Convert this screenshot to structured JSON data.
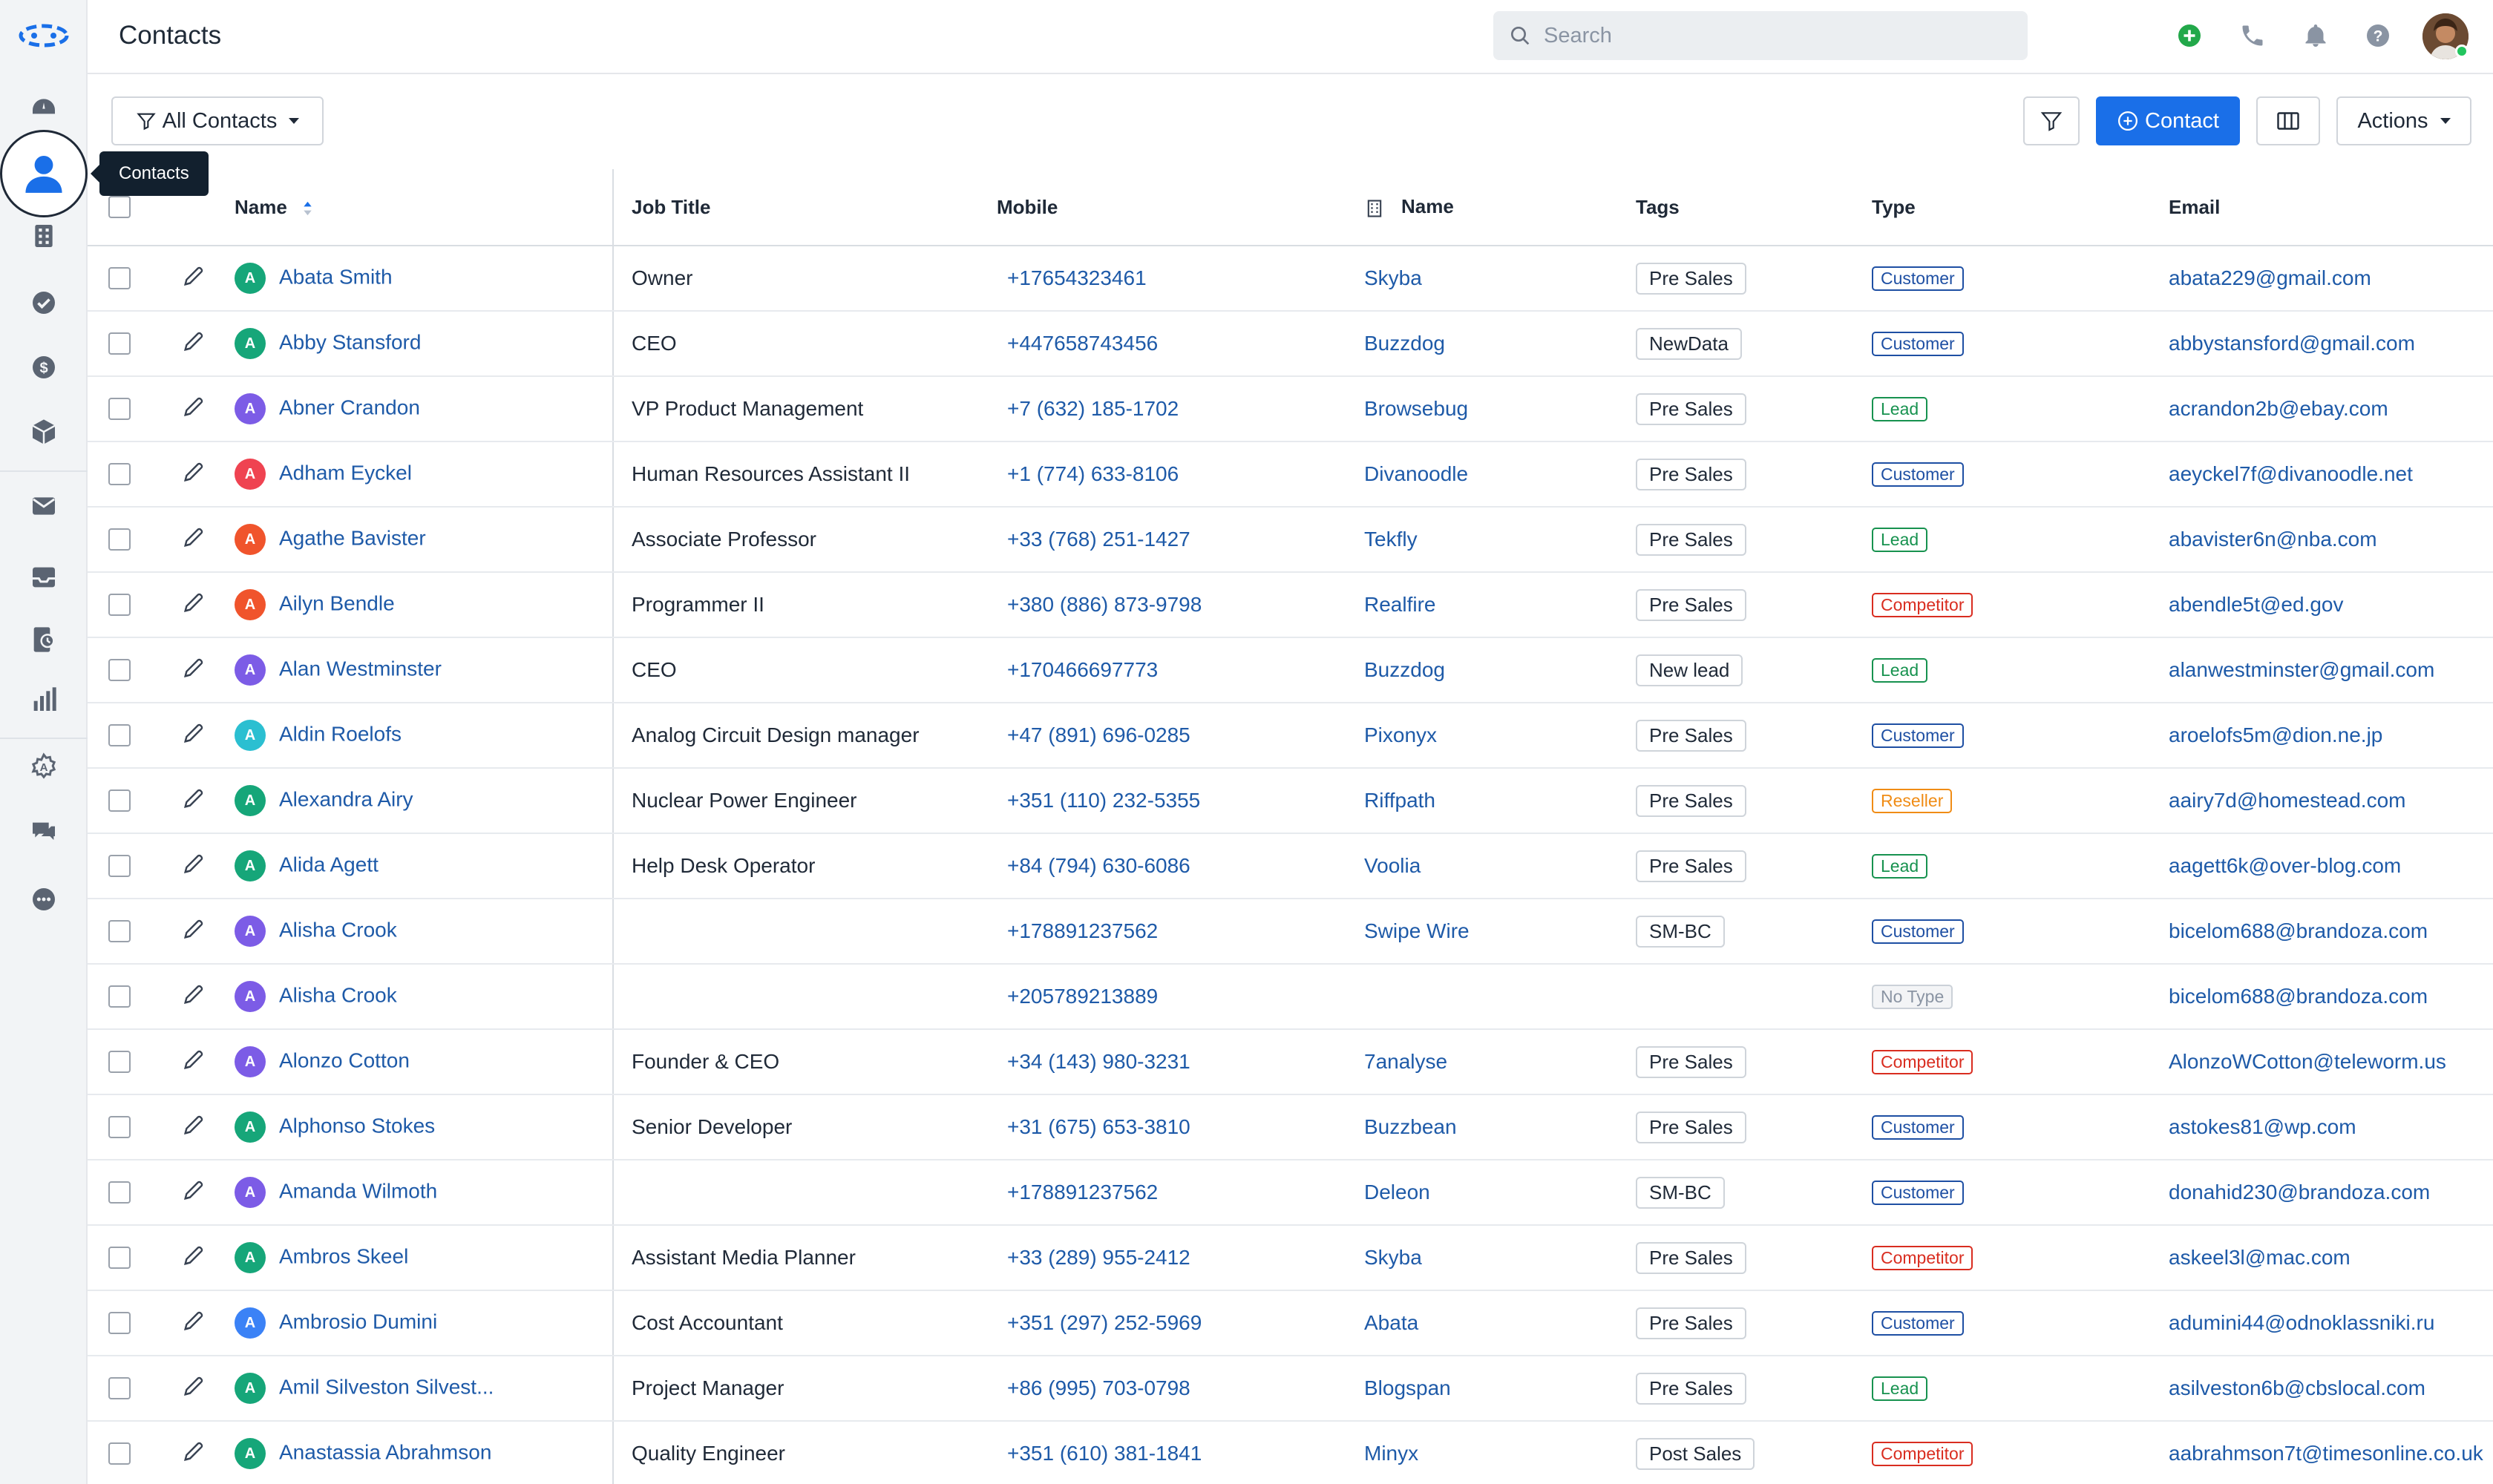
{
  "header": {
    "title": "Contacts",
    "search_placeholder": "Search"
  },
  "sidebar": {
    "items": [
      "dashboard",
      "contacts",
      "companies",
      "tasks",
      "deals",
      "products",
      "email",
      "inbox",
      "documents",
      "reports",
      "automations",
      "chat",
      "more"
    ],
    "active_tooltip": "Contacts"
  },
  "toolbar": {
    "view_label": "All Contacts",
    "add_label": "Contact",
    "actions_label": "Actions"
  },
  "table": {
    "columns": {
      "name": "Name",
      "job_title": "Job Title",
      "mobile": "Mobile",
      "company_name": "Name",
      "tags": "Tags",
      "type": "Type",
      "email": "Email"
    },
    "rows": [
      {
        "initial": "A",
        "avatar_color": "#16a679",
        "name": "Abata Smith",
        "job": "Owner",
        "mobile": "+17654323461",
        "company": "Skyba",
        "tag": "Pre Sales",
        "type": "Customer",
        "email": "abata229@gmail.com"
      },
      {
        "initial": "A",
        "avatar_color": "#16a679",
        "name": "Abby Stansford",
        "job": "CEO",
        "mobile": "+447658743456",
        "company": "Buzzdog",
        "tag": "NewData",
        "type": "Customer",
        "email": "abbystansford@gmail.com"
      },
      {
        "initial": "A",
        "avatar_color": "#7c5ce6",
        "name": "Abner Crandon",
        "job": "VP Product Management",
        "mobile": "+7 (632) 185-1702",
        "company": "Browsebug",
        "tag": "Pre Sales",
        "type": "Lead",
        "email": "acrandon2b@ebay.com"
      },
      {
        "initial": "A",
        "avatar_color": "#ef4351",
        "name": "Adham Eyckel",
        "job": "Human Resources Assistant II",
        "mobile": "+1 (774) 633-8106",
        "company": "Divanoodle",
        "tag": "Pre Sales",
        "type": "Customer",
        "email": "aeyckel7f@divanoodle.net"
      },
      {
        "initial": "A",
        "avatar_color": "#f0542c",
        "name": "Agathe Bavister",
        "job": "Associate Professor",
        "mobile": "+33 (768) 251-1427",
        "company": "Tekfly",
        "tag": "Pre Sales",
        "type": "Lead",
        "email": "abavister6n@nba.com"
      },
      {
        "initial": "A",
        "avatar_color": "#f0542c",
        "name": "Ailyn Bendle",
        "job": "Programmer II",
        "mobile": "+380 (886) 873-9798",
        "company": "Realfire",
        "tag": "Pre Sales",
        "type": "Competitor",
        "email": "abendle5t@ed.gov"
      },
      {
        "initial": "A",
        "avatar_color": "#7c5ce6",
        "name": "Alan Westminster",
        "job": "CEO",
        "mobile": "+170466697773",
        "company": "Buzzdog",
        "tag": "New lead",
        "type": "Lead",
        "email": "alanwestminster@gmail.com"
      },
      {
        "initial": "A",
        "avatar_color": "#2bbfd1",
        "name": "Aldin Roelofs",
        "job": "Analog Circuit Design manager",
        "mobile": "+47 (891) 696-0285",
        "company": "Pixonyx",
        "tag": "Pre Sales",
        "type": "Customer",
        "email": "aroelofs5m@dion.ne.jp"
      },
      {
        "initial": "A",
        "avatar_color": "#16a679",
        "name": "Alexandra Airy",
        "job": "Nuclear Power Engineer",
        "mobile": "+351 (110) 232-5355",
        "company": "Riffpath",
        "tag": "Pre Sales",
        "type": "Reseller",
        "email": "aairy7d@homestead.com"
      },
      {
        "initial": "A",
        "avatar_color": "#16a679",
        "name": "Alida Agett",
        "job": "Help Desk Operator",
        "mobile": "+84 (794) 630-6086",
        "company": "Voolia",
        "tag": "Pre Sales",
        "type": "Lead",
        "email": "aagett6k@over-blog.com"
      },
      {
        "initial": "A",
        "avatar_color": "#7c5ce6",
        "name": "Alisha Crook",
        "job": "",
        "mobile": "+178891237562",
        "company": "Swipe Wire",
        "tag": "SM-BC",
        "type": "Customer",
        "email": "bicelom688@brandoza.com"
      },
      {
        "initial": "A",
        "avatar_color": "#7c5ce6",
        "name": "Alisha Crook",
        "job": "",
        "mobile": "+205789213889",
        "company": "",
        "tag": "",
        "type": "No Type",
        "email": "bicelom688@brandoza.com"
      },
      {
        "initial": "A",
        "avatar_color": "#7c5ce6",
        "name": "Alonzo Cotton",
        "job": "Founder & CEO",
        "mobile": "+34 (143) 980-3231",
        "company": "7analyse",
        "tag": "Pre Sales",
        "type": "Competitor",
        "email": "AlonzoWCotton@teleworm.us"
      },
      {
        "initial": "A",
        "avatar_color": "#16a679",
        "name": "Alphonso Stokes",
        "job": "Senior Developer",
        "mobile": "+31 (675) 653-3810",
        "company": "Buzzbean",
        "tag": "Pre Sales",
        "type": "Customer",
        "email": "astokes81@wp.com"
      },
      {
        "initial": "A",
        "avatar_color": "#7c5ce6",
        "name": "Amanda Wilmoth",
        "job": "",
        "mobile": "+178891237562",
        "company": "Deleon",
        "tag": "SM-BC",
        "type": "Customer",
        "email": "donahid230@brandoza.com"
      },
      {
        "initial": "A",
        "avatar_color": "#16a679",
        "name": "Ambros Skeel",
        "job": "Assistant Media Planner",
        "mobile": "+33 (289) 955-2412",
        "company": "Skyba",
        "tag": "Pre Sales",
        "type": "Competitor",
        "email": "askeel3l@mac.com"
      },
      {
        "initial": "A",
        "avatar_color": "#3b82f6",
        "name": "Ambrosio Dumini",
        "job": "Cost Accountant",
        "mobile": "+351 (297) 252-5969",
        "company": "Abata",
        "tag": "Pre Sales",
        "type": "Customer",
        "email": "adumini44@odnoklassniki.ru"
      },
      {
        "initial": "A",
        "avatar_color": "#16a679",
        "name": "Amil Silveston Silvest...",
        "job": "Project Manager",
        "mobile": "+86 (995) 703-0798",
        "company": "Blogspan",
        "tag": "Pre Sales",
        "type": "Lead",
        "email": "asilveston6b@cbslocal.com"
      },
      {
        "initial": "A",
        "avatar_color": "#16a679",
        "name": "Anastassia Abrahmson",
        "job": "Quality Engineer",
        "mobile": "+351 (610) 381-1841",
        "company": "Minyx",
        "tag": "Post Sales",
        "type": "Competitor",
        "email": "aabrahmson7t@timesonline.co.uk"
      }
    ]
  },
  "type_colors": {
    "Customer": "#1e4fa3",
    "Lead": "#17924f",
    "Competitor": "#d92d20",
    "Reseller": "#f08c15",
    "No Type": "#8a94a3"
  },
  "colors": {
    "primary": "#1a6fe8",
    "link": "#1e5aa8",
    "sidebar_bg": "#f2f4f6",
    "add_green": "#22a84a"
  }
}
